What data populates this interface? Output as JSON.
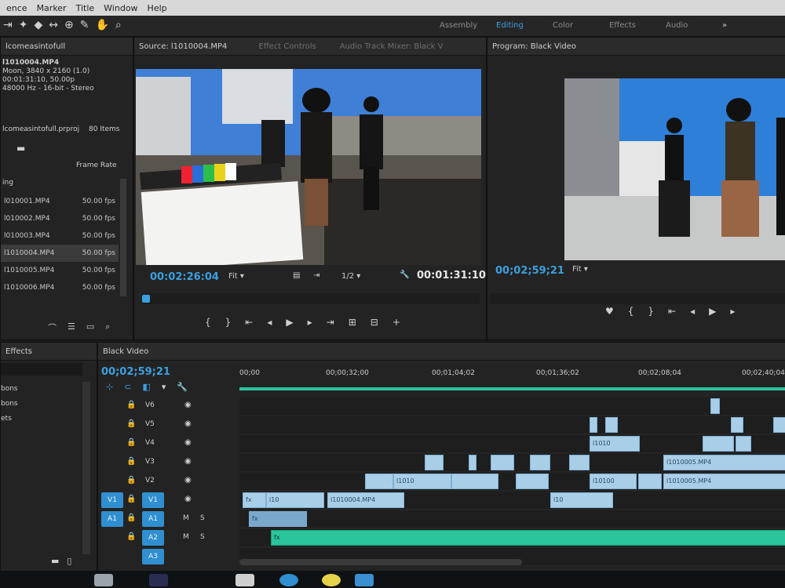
{
  "menu": [
    "ence",
    "Marker",
    "Title",
    "Window",
    "Help"
  ],
  "workspaces": {
    "items": [
      "Assembly",
      "Editing",
      "Color",
      "Effects",
      "Audio"
    ],
    "active": "Editing",
    "more": "»"
  },
  "project": {
    "name": "lcomeasintofull",
    "clip": "l1010004.MP4",
    "meta": [
      "Moon, 3840 x 2160 (1.0)",
      "00:01:31:10, 50.00p",
      "48000 Hz - 16-bit - Stereo"
    ],
    "file": "lcomeasintofull.prproj",
    "count": "80 Items",
    "col_header": "Frame Rate",
    "first_row": "ing",
    "rows": [
      {
        "name": "l010001.MP4",
        "fps": "50.00 fps"
      },
      {
        "name": "l010002.MP4",
        "fps": "50.00 fps"
      },
      {
        "name": "l010003.MP4",
        "fps": "50.00 fps"
      },
      {
        "name": "l1010004.MP4",
        "fps": "50.00 fps"
      },
      {
        "name": "l1010005.MP4",
        "fps": "50.00 fps"
      },
      {
        "name": "l1010006.MP4",
        "fps": "50.00 fps"
      }
    ]
  },
  "source": {
    "title": "Source: l1010004.MP4",
    "tab2": "Effect Controls",
    "tab3": "Audio Track Mixer: Black V",
    "timecode": "00:02:26:04",
    "fit": "Fit",
    "res": "1/2",
    "duration": "00:01:31:10"
  },
  "program": {
    "title": "Program: Black Video",
    "timecode": "00;02;59;21",
    "fit": "Fit"
  },
  "effects": {
    "title": "Effects",
    "items": [
      "",
      "",
      "bons",
      "",
      "bons",
      "ets"
    ]
  },
  "timeline": {
    "title": "Black Video",
    "timecode": "00;02;59;21",
    "ruler": [
      "00;00",
      "00;00;32;00",
      "00;01;04;02",
      "00;01;36;02",
      "00;02;08;04",
      "00;02;40;04"
    ],
    "video_tracks": [
      "V6",
      "V5",
      "V4",
      "V3",
      "V2",
      "V1"
    ],
    "audio_tracks": [
      "A1",
      "A2",
      "A3"
    ],
    "src_v": "V1",
    "src_a": "A1",
    "clips": {
      "v1_a": "fx",
      "v1_b": "l10",
      "v1_c": "l1010004.MP4",
      "v3_a": "l1010",
      "v2_a": "l10",
      "v3_b": "l10100",
      "v4_a": "l1010",
      "v5_a": "l1010005.MP4",
      "v4_b": "l1010005.MP4",
      "a1": "fx",
      "a2": "fx"
    }
  }
}
